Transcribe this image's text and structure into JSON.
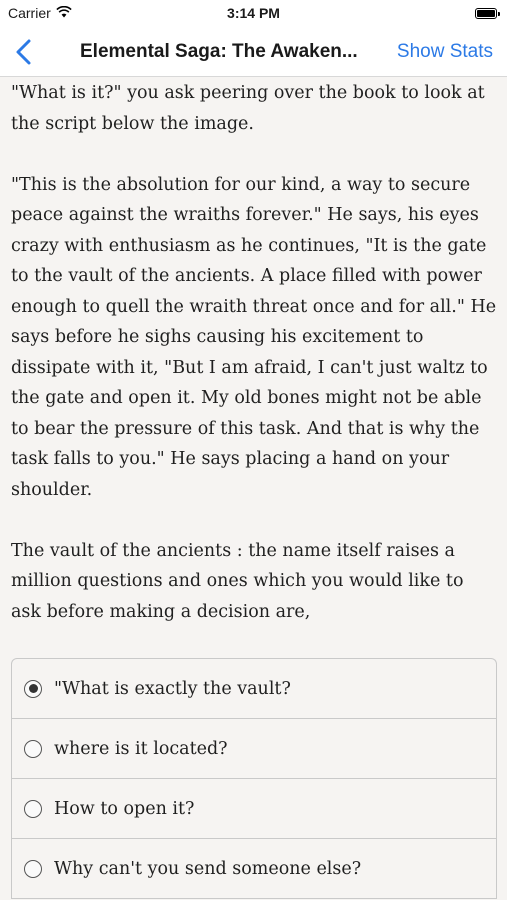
{
  "status_bar": {
    "carrier": "Carrier",
    "time": "3:14 PM",
    "wifi_icon": "wifi-icon",
    "battery_icon": "battery-icon"
  },
  "nav": {
    "back_icon": "chevron-left-icon",
    "title": "Elemental Saga: The Awaken...",
    "show_stats": "Show Stats",
    "accent_color": "#2c7ae6"
  },
  "story": {
    "paragraphs": [
      "\"What is it?\" you ask peering over the book to look at the script below the image.",
      "\"This is the absolution for our kind, a way to secure peace against the wraiths forever.\" He says, his eyes crazy with enthusiasm as he continues, \"It is the gate to the vault of the ancients. A place filled with power enough to quell the wraith threat once and for all.\" He says before he sighs causing his excitement to dissipate with it, \"But I am afraid, I can't just waltz to the gate and open it. My old bones might not be able to bear the pressure of this task. And that is why the task falls to you.\" He says placing a hand on your shoulder.",
      "The vault of the ancients : the name itself raises a million questions and ones which you would like to ask before making a decision are,"
    ]
  },
  "choices": [
    {
      "label": "\"What is exactly the vault?",
      "selected": true
    },
    {
      "label": "where is it located?",
      "selected": false
    },
    {
      "label": "How to open it?",
      "selected": false
    },
    {
      "label": "Why can't you send someone else?",
      "selected": false
    }
  ]
}
